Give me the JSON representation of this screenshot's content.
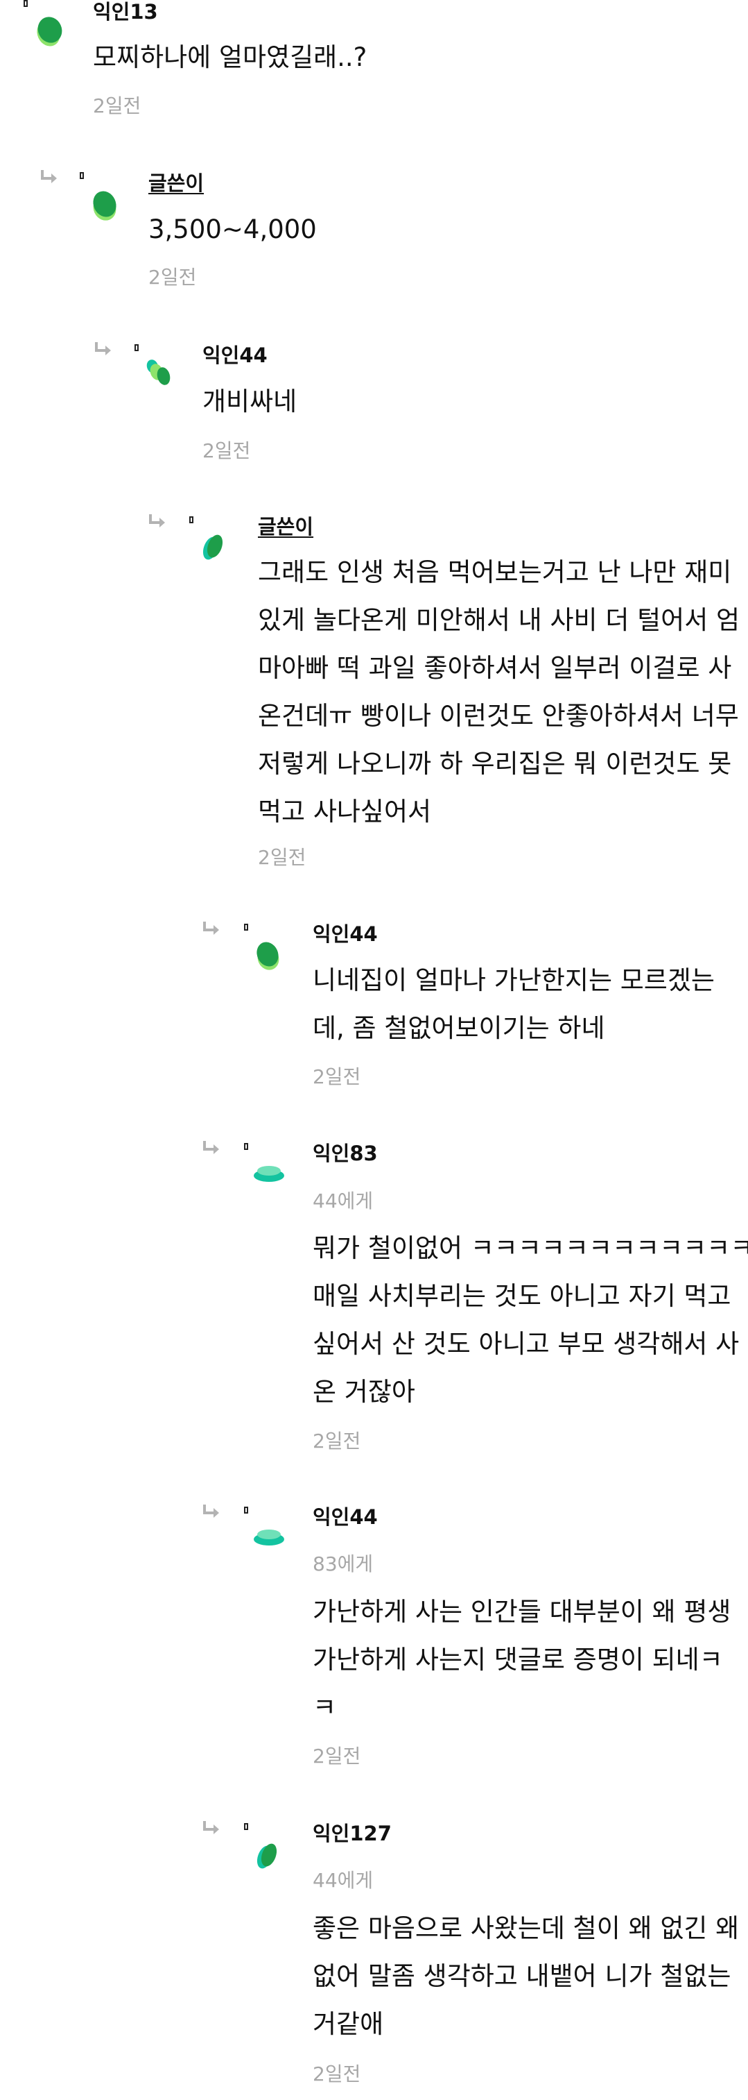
{
  "colors": {
    "avatar_dark_green": "#1e9e4a",
    "avatar_light_green": "#8ee36b",
    "avatar_teal": "#13c3a0",
    "text": "#111111",
    "meta": "#a7a7a7",
    "divider": "#ececec"
  },
  "comments": [
    {
      "author": "익인13",
      "is_op": false,
      "mention": "",
      "lines": [
        "모찌하나에 얼마였길래..?"
      ],
      "time": "2일전",
      "avatar_icon": "green-blob-avatar-icon"
    },
    {
      "author": "글쓴이",
      "is_op": true,
      "mention": "",
      "lines": [
        "3,500~4,000"
      ],
      "time": "2일전",
      "avatar_icon": "green-blob-avatar-icon"
    },
    {
      "author": "익인44",
      "is_op": false,
      "mention": "",
      "lines": [
        "개비싸네"
      ],
      "time": "2일전",
      "avatar_icon": "multi-blob-avatar-icon"
    },
    {
      "author": "글쓴이",
      "is_op": true,
      "mention": "",
      "lines": [
        "그래도 인생 처음 먹어보는거고 난 나만 재미",
        "있게 놀다온게 미안해서 내 사비 더 털어서 엄",
        "마아빠 떡 과일 좋아하셔서 일부러 이걸로 사",
        "온건데ㅠ 빵이나 이런것도 안좋아하셔서 너무",
        "저렇게 나오니까 하 우리집은 뭐 이런것도 못",
        "먹고 사나싶어서"
      ],
      "time": "2일전",
      "avatar_icon": "tilted-blob-avatar-icon"
    },
    {
      "author": "익인44",
      "is_op": false,
      "mention": "",
      "lines": [
        "니네집이 얼마나 가난한지는 모르겠는",
        "데, 좀 철없어보이기는 하네"
      ],
      "time": "2일전",
      "avatar_icon": "green-blob-avatar-icon"
    },
    {
      "author": "익인83",
      "is_op": false,
      "mention": "44에게",
      "lines": [
        "뭐가 철이없어 ㅋㅋㅋㅋㅋㅋㅋㅋㅋㅋㅋㅋ",
        "매일 사치부리는 것도 아니고 자기 먹고",
        "싶어서 산 것도 아니고 부모 생각해서 사",
        "온 거잖아"
      ],
      "time": "2일전",
      "avatar_icon": "flat-disc-avatar-icon"
    },
    {
      "author": "익인44",
      "is_op": false,
      "mention": "83에게",
      "lines": [
        "가난하게 사는 인간들 대부분이 왜 평생",
        "가난하게 사는지 댓글로 증명이 되네ㅋ",
        "ㅋ"
      ],
      "time": "2일전",
      "avatar_icon": "flat-disc-avatar-icon"
    },
    {
      "author": "익인127",
      "is_op": false,
      "mention": "44에게",
      "lines": [
        "좋은 마음으로 사왔는데 철이 왜 없긴 왜",
        "없어 말좀 생각하고 내뱉어 니가 철없는",
        "거같애"
      ],
      "time": "2일전",
      "avatar_icon": "tilted-blob-avatar-icon"
    }
  ]
}
